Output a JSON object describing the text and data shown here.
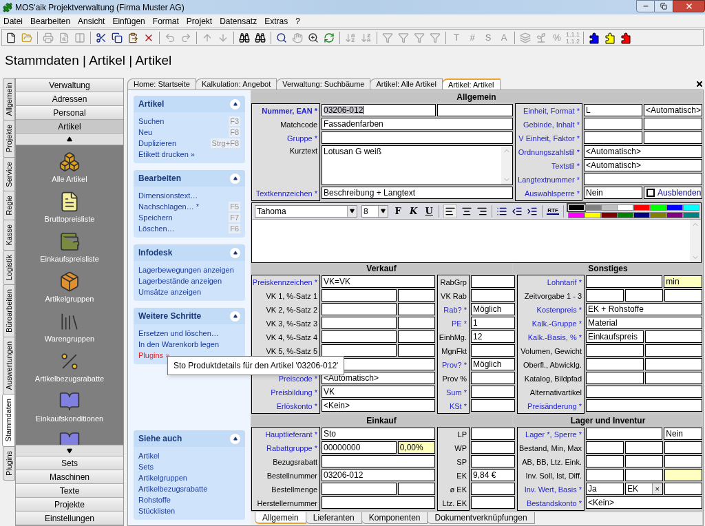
{
  "window": {
    "title": "MOS'aik Projektverwaltung (Firma Muster AG)"
  },
  "menu": [
    "Datei",
    "Bearbeiten",
    "Ansicht",
    "Einfügen",
    "Format",
    "Projekt",
    "Datensatz",
    "Extras",
    "?"
  ],
  "toolbar": [
    [
      {
        "disabled": false
      },
      {
        "disabled": false
      }
    ],
    [
      {
        "disabled": true
      },
      {
        "disabled": true
      },
      {
        "disabled": true
      }
    ],
    [
      {
        "disabled": false
      },
      {
        "disabled": false
      },
      {
        "disabled": false
      },
      {
        "disabled": false
      }
    ],
    [
      {
        "disabled": true
      },
      {
        "disabled": true
      }
    ],
    [
      {
        "disabled": true
      },
      {
        "disabled": true
      }
    ],
    [
      {
        "disabled": false
      },
      {
        "disabled": false
      }
    ],
    [
      {
        "disabled": false
      },
      {
        "disabled": true
      },
      {
        "disabled": false
      },
      {
        "disabled": false
      }
    ],
    [
      {
        "disabled": true
      },
      {
        "disabled": true
      }
    ],
    [
      {
        "disabled": true
      },
      {
        "disabled": true
      },
      {
        "disabled": true
      },
      {
        "disabled": true
      }
    ],
    [
      {
        "glyph": "T",
        "disabled": true
      },
      {
        "glyph": "#",
        "disabled": true
      },
      {
        "glyph": "S",
        "disabled": true
      },
      {
        "glyph": "A",
        "disabled": true
      }
    ],
    [
      {
        "disabled": true
      },
      {
        "disabled": true
      },
      {
        "glyph": "%",
        "disabled": true
      },
      {
        "glyph": "1.1.1\n1.1.2",
        "disabled": true
      }
    ],
    [
      {
        "disabled": false,
        "color": "#0000ff"
      },
      {
        "disabled": false,
        "color": "#ffff00"
      },
      {
        "disabled": false,
        "color": "#ff0000"
      }
    ]
  ],
  "page_title": "Stammdaten | Artikel | Artikel",
  "vertical_tabs": [
    {
      "label": "Allgemein",
      "selected": false
    },
    {
      "label": "Projekte",
      "selected": false
    },
    {
      "label": "Service",
      "selected": false
    },
    {
      "label": "Regie",
      "selected": false
    },
    {
      "label": "Kasse",
      "selected": false
    },
    {
      "label": "Logistik",
      "selected": false
    },
    {
      "label": "Büroarbeiten",
      "selected": false
    },
    {
      "label": "Auswertungen",
      "selected": false
    },
    {
      "label": "Stammdaten",
      "selected": true
    },
    {
      "label": "Plugins",
      "selected": false
    }
  ],
  "nav": {
    "top_buttons": [
      {
        "label": "Verwaltung",
        "selected": false
      },
      {
        "label": "Adressen",
        "selected": false
      },
      {
        "label": "Personal",
        "selected": false
      },
      {
        "label": "Artikel",
        "selected": true
      }
    ],
    "items": [
      {
        "label": "Alle Artikel"
      },
      {
        "label": "Bruttopreisliste"
      },
      {
        "label": "Einkaufspreisliste"
      },
      {
        "label": "Artikelgruppen"
      },
      {
        "label": "Warengruppen"
      },
      {
        "label": "Artikelbezugsrabatte"
      },
      {
        "label": "Einkaufskonditionen"
      }
    ],
    "bottom_buttons": [
      {
        "label": "Sets",
        "selected": false
      },
      {
        "label": "Maschinen",
        "selected": false
      },
      {
        "label": "Texte",
        "selected": false
      },
      {
        "label": "Projekte",
        "selected": false
      },
      {
        "label": "Einstellungen",
        "selected": false
      }
    ]
  },
  "doc_tabs": [
    {
      "label": "Home: Startseite",
      "selected": false
    },
    {
      "label": "Kalkulation: Angebot",
      "selected": false
    },
    {
      "label": "Verwaltung: Suchbäume",
      "selected": false
    },
    {
      "label": "Artikel: Alle Artikel",
      "selected": false
    },
    {
      "label": "Artikel: Artikel",
      "selected": true
    }
  ],
  "task_pane": {
    "sections": [
      {
        "title": "Artikel",
        "items": [
          {
            "label": "Suchen",
            "shortcut": "F3",
            "hovered": false
          },
          {
            "label": "Neu",
            "shortcut": "F8",
            "hovered": false
          },
          {
            "label": "Duplizieren",
            "shortcut": "Strg+F8",
            "hovered": false
          },
          {
            "label": "Etikett drucken »",
            "hovered": false
          }
        ]
      },
      {
        "title": "Bearbeiten",
        "items": [
          {
            "label": "Dimensionstext…",
            "hovered": false
          },
          {
            "label": "Nachschlagen… *",
            "shortcut": "F5",
            "hovered": false
          },
          {
            "label": "Speichern",
            "shortcut": "F7",
            "hovered": false
          },
          {
            "label": "Löschen…",
            "shortcut": "F6",
            "hovered": false
          }
        ]
      },
      {
        "title": "Infodesk",
        "items": [
          {
            "label": "Lagerbewegungen anzeigen",
            "hovered": false
          },
          {
            "label": "Lagerbestände anzeigen",
            "hovered": false
          },
          {
            "label": "Umsätze anzeigen",
            "hovered": false
          }
        ]
      },
      {
        "title": "Weitere Schritte",
        "items": [
          {
            "label": "Ersetzen und löschen…",
            "hovered": false
          },
          {
            "label": "In den Warenkorb legen",
            "hovered": false
          },
          {
            "label": "Plugins »",
            "hovered": true
          }
        ]
      }
    ],
    "see_also": {
      "title": "Siehe auch",
      "items": [
        {
          "label": "Artikel",
          "hovered": false
        },
        {
          "label": "Sets",
          "hovered": false
        },
        {
          "label": "Artikelgruppen",
          "hovered": false
        },
        {
          "label": "Artikelbezugsrabatte",
          "hovered": false
        },
        {
          "label": "Rohstoffe",
          "hovered": false
        },
        {
          "label": "Stücklisten",
          "hovered": false
        }
      ]
    }
  },
  "tooltip": "Sto Produktdetails für den Artikel '03206-012'",
  "form": {
    "allgemein": {
      "headers": [
        "Allgemein"
      ],
      "blocks": [
        [
          {
            "label": "Nummer, EAN *",
            "required": true,
            "focused": true,
            "kind": "split",
            "value": "03206-012"
          },
          {
            "label": "Matchcode",
            "required": false,
            "kind": "single",
            "value": "Fassadenfarben"
          },
          {
            "label": "Gruppe *",
            "required": true,
            "kind": "single"
          },
          {
            "label": "Kurztext",
            "required": false,
            "kind": "textarea",
            "value": "Lotusan G weiß"
          },
          {
            "label": "Textkennzeichen *",
            "required": true,
            "kind": "single",
            "value": "Beschreibung + Langtext"
          }
        ],
        [
          {
            "label": "Einheit, Format *",
            "required": true,
            "kind": "pair",
            "value": "L",
            "value_2": "<Automatisch>"
          },
          {
            "label": "Gebinde, Inhalt *",
            "required": true,
            "kind": "pair"
          },
          {
            "label": "V Einheit, Faktor *",
            "required": true,
            "kind": "pair"
          },
          {
            "label": "Ordnungszahlstil *",
            "required": true,
            "kind": "single",
            "value": "<Automatisch>"
          },
          {
            "label": "Textstil *",
            "required": true,
            "kind": "single",
            "value": "<Automatisch>"
          },
          {
            "label": "Langtextnummer *",
            "required": true,
            "kind": "single"
          },
          {
            "label": "Auswahlsperre *",
            "required": true,
            "kind": "check",
            "value": "Nein",
            "checkbox": {
              "label": "Ausblenden",
              "checked": false
            }
          }
        ]
      ]
    },
    "editor": {
      "font": "Tahoma",
      "size": "8",
      "styles": [
        "F",
        "K",
        "U"
      ],
      "rtf": "RTF",
      "colors": [
        {
          "color": "#000000",
          "selected": true
        },
        {
          "color": "#808080",
          "selected": false
        },
        {
          "color": "#c0c0c0",
          "selected": false
        },
        {
          "color": "#ffffff",
          "selected": false
        },
        {
          "color": "#ff0000",
          "selected": false
        },
        {
          "color": "#00ff00",
          "selected": false
        },
        {
          "color": "#0000ff",
          "selected": false
        },
        {
          "color": "#00ffff",
          "selected": false
        },
        {
          "color": "#ff00ff",
          "selected": false
        },
        {
          "color": "#ffff00",
          "selected": false
        },
        {
          "color": "#800000",
          "selected": false
        },
        {
          "color": "#008000",
          "selected": false
        },
        {
          "color": "#000080",
          "selected": false
        },
        {
          "color": "#808000",
          "selected": false
        },
        {
          "color": "#800080",
          "selected": false
        },
        {
          "color": "#008080",
          "selected": false
        }
      ]
    },
    "verkauf": {
      "headers": [
        "Verkauf",
        "Sonstiges"
      ],
      "blocks": [
        [
          {
            "label": "Preiskennzeichen *",
            "required": true,
            "kind": "single",
            "value": "VK=VK"
          },
          {
            "label": "VK 1, %-Satz 1",
            "required": false,
            "kind": "wide_narrow"
          },
          {
            "label": "VK 2, %-Satz 2",
            "required": false,
            "kind": "wide_narrow"
          },
          {
            "label": "VK 3, %-Satz 3",
            "required": false,
            "kind": "wide_narrow"
          },
          {
            "label": "VK 4, %-Satz 4",
            "required": false,
            "kind": "wide_narrow"
          },
          {
            "label": "VK 5, %-Satz 5",
            "required": false,
            "kind": "wide_narrow"
          },
          {
            "kind": "single"
          },
          {
            "label": "Preiscode *",
            "required": true,
            "kind": "single",
            "value": "<Automatisch>"
          },
          {
            "label": "Preisbildung *",
            "required": true,
            "kind": "single",
            "value": "VK"
          },
          {
            "label": "Erlöskonto *",
            "required": true,
            "kind": "single",
            "value": "<Kein>"
          }
        ],
        [
          {
            "label": "RabGrp",
            "required": false,
            "kind": "single"
          },
          {
            "label": "VK Rab",
            "required": false,
            "kind": "single"
          },
          {
            "label": "Rab? *",
            "required": true,
            "kind": "single",
            "value": "Möglich"
          },
          {
            "label": "PE *",
            "required": true,
            "kind": "single",
            "value": "1"
          },
          {
            "label": "EinhMg.",
            "required": false,
            "kind": "single",
            "value": "12"
          },
          {
            "label": "MgnFkt",
            "required": false,
            "kind": "single"
          },
          {
            "label": "Prov? *",
            "required": true,
            "kind": "single",
            "value": "Möglich"
          },
          {
            "label": "Prov %",
            "required": false,
            "kind": "single"
          },
          {
            "label": "Sum *",
            "required": true,
            "kind": "single"
          },
          {
            "label": "KSt *",
            "required": true,
            "kind": "single"
          }
        ],
        [
          {
            "label": "Lohntarif *",
            "required": true,
            "kind": "wide_narrow",
            "value_2": "min",
            "highlight_2": true
          },
          {
            "label": "Zeitvorgabe 1 - 3",
            "required": false,
            "kind": "triple"
          },
          {
            "label": "Kostenpreis *",
            "required": true,
            "kind": "single",
            "value": "EK + Rohstoffe"
          },
          {
            "label": "Kalk.-Gruppe *",
            "required": true,
            "kind": "single",
            "value": "Material"
          },
          {
            "label": "Kalk.-Basis, % *",
            "required": true,
            "kind": "pair",
            "value": "Einkaufspreis"
          },
          {
            "label": "Volumen, Gewicht",
            "required": false,
            "kind": "pair"
          },
          {
            "label": "Oberfl., Abwicklg.",
            "required": false,
            "kind": "pair"
          },
          {
            "label": "Katalog, Bildpfad",
            "required": false,
            "kind": "pair"
          },
          {
            "label": "Alternativartikel",
            "required": false,
            "kind": "single"
          },
          {
            "label": "Preisänderung *",
            "required": true,
            "kind": "single"
          }
        ]
      ]
    },
    "einkauf": {
      "headers": [
        "Einkauf",
        "Lager und Inventur"
      ],
      "blocks": [
        [
          {
            "label": "Hauptlieferant *",
            "required": true,
            "kind": "single",
            "value": "Sto"
          },
          {
            "label": "Rabattgruppe *",
            "required": true,
            "kind": "wide_narrow",
            "value": "00000000",
            "value_2": "0,00%",
            "highlight_2": true
          },
          {
            "label": "Bezugsrabatt",
            "required": false,
            "kind": "single"
          },
          {
            "label": "Bestellnummer",
            "required": false,
            "kind": "single",
            "value": "03206-012"
          },
          {
            "label": "Bestellmenge",
            "required": false,
            "kind": "wide_narrow"
          },
          {
            "label": "Herstellernummer",
            "required": false,
            "kind": "single"
          }
        ],
        [
          {
            "label": "LP",
            "required": false,
            "kind": "single"
          },
          {
            "label": "WP",
            "required": false,
            "kind": "single"
          },
          {
            "label": "SP",
            "required": false,
            "kind": "single"
          },
          {
            "label": "EK",
            "required": false,
            "kind": "single",
            "value": "9,84 €"
          },
          {
            "label": "ø EK",
            "required": false,
            "kind": "single"
          },
          {
            "label": "Ltz. EK",
            "required": false,
            "kind": "single"
          }
        ],
        [
          {
            "label": "Lager *, Sperre *",
            "required": true,
            "kind": "wide_narrow",
            "value_2": "Nein"
          },
          {
            "label": "Bestand, Min, Max",
            "required": false,
            "kind": "triple"
          },
          {
            "label": "AB, BB, Ltz. Eink.",
            "required": false,
            "kind": "triple"
          },
          {
            "label": "Inv. Soll, Ist, Diff.",
            "required": false,
            "kind": "triple",
            "highlight_3": true
          },
          {
            "label": "Inv. Wert, Basis *",
            "required": true,
            "kind": "triple",
            "value": "Ja",
            "value_2": "EK",
            "button_2": "×"
          },
          {
            "label": "Bestandskonto *",
            "required": true,
            "kind": "single",
            "value": "<Kein>"
          }
        ]
      ]
    }
  },
  "bottom_tabs": [
    {
      "label": "Allgemein",
      "selected": true
    },
    {
      "label": "Lieferanten",
      "selected": false
    },
    {
      "label": "Komponenten",
      "selected": false
    },
    {
      "label": "Dokumentverknüpfungen",
      "selected": false
    }
  ]
}
